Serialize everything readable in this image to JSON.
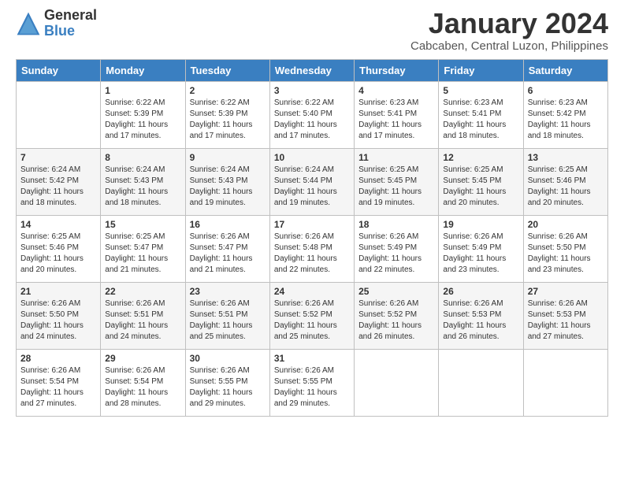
{
  "logo": {
    "general": "General",
    "blue": "Blue"
  },
  "title": "January 2024",
  "location": "Cabcaben, Central Luzon, Philippines",
  "days_of_week": [
    "Sunday",
    "Monday",
    "Tuesday",
    "Wednesday",
    "Thursday",
    "Friday",
    "Saturday"
  ],
  "weeks": [
    [
      {
        "day": "",
        "sunrise": "",
        "sunset": "",
        "daylight": ""
      },
      {
        "day": "1",
        "sunrise": "Sunrise: 6:22 AM",
        "sunset": "Sunset: 5:39 PM",
        "daylight": "Daylight: 11 hours and 17 minutes."
      },
      {
        "day": "2",
        "sunrise": "Sunrise: 6:22 AM",
        "sunset": "Sunset: 5:39 PM",
        "daylight": "Daylight: 11 hours and 17 minutes."
      },
      {
        "day": "3",
        "sunrise": "Sunrise: 6:22 AM",
        "sunset": "Sunset: 5:40 PM",
        "daylight": "Daylight: 11 hours and 17 minutes."
      },
      {
        "day": "4",
        "sunrise": "Sunrise: 6:23 AM",
        "sunset": "Sunset: 5:41 PM",
        "daylight": "Daylight: 11 hours and 17 minutes."
      },
      {
        "day": "5",
        "sunrise": "Sunrise: 6:23 AM",
        "sunset": "Sunset: 5:41 PM",
        "daylight": "Daylight: 11 hours and 18 minutes."
      },
      {
        "day": "6",
        "sunrise": "Sunrise: 6:23 AM",
        "sunset": "Sunset: 5:42 PM",
        "daylight": "Daylight: 11 hours and 18 minutes."
      }
    ],
    [
      {
        "day": "7",
        "sunrise": "Sunrise: 6:24 AM",
        "sunset": "Sunset: 5:42 PM",
        "daylight": "Daylight: 11 hours and 18 minutes."
      },
      {
        "day": "8",
        "sunrise": "Sunrise: 6:24 AM",
        "sunset": "Sunset: 5:43 PM",
        "daylight": "Daylight: 11 hours and 18 minutes."
      },
      {
        "day": "9",
        "sunrise": "Sunrise: 6:24 AM",
        "sunset": "Sunset: 5:43 PM",
        "daylight": "Daylight: 11 hours and 19 minutes."
      },
      {
        "day": "10",
        "sunrise": "Sunrise: 6:24 AM",
        "sunset": "Sunset: 5:44 PM",
        "daylight": "Daylight: 11 hours and 19 minutes."
      },
      {
        "day": "11",
        "sunrise": "Sunrise: 6:25 AM",
        "sunset": "Sunset: 5:45 PM",
        "daylight": "Daylight: 11 hours and 19 minutes."
      },
      {
        "day": "12",
        "sunrise": "Sunrise: 6:25 AM",
        "sunset": "Sunset: 5:45 PM",
        "daylight": "Daylight: 11 hours and 20 minutes."
      },
      {
        "day": "13",
        "sunrise": "Sunrise: 6:25 AM",
        "sunset": "Sunset: 5:46 PM",
        "daylight": "Daylight: 11 hours and 20 minutes."
      }
    ],
    [
      {
        "day": "14",
        "sunrise": "Sunrise: 6:25 AM",
        "sunset": "Sunset: 5:46 PM",
        "daylight": "Daylight: 11 hours and 20 minutes."
      },
      {
        "day": "15",
        "sunrise": "Sunrise: 6:25 AM",
        "sunset": "Sunset: 5:47 PM",
        "daylight": "Daylight: 11 hours and 21 minutes."
      },
      {
        "day": "16",
        "sunrise": "Sunrise: 6:26 AM",
        "sunset": "Sunset: 5:47 PM",
        "daylight": "Daylight: 11 hours and 21 minutes."
      },
      {
        "day": "17",
        "sunrise": "Sunrise: 6:26 AM",
        "sunset": "Sunset: 5:48 PM",
        "daylight": "Daylight: 11 hours and 22 minutes."
      },
      {
        "day": "18",
        "sunrise": "Sunrise: 6:26 AM",
        "sunset": "Sunset: 5:49 PM",
        "daylight": "Daylight: 11 hours and 22 minutes."
      },
      {
        "day": "19",
        "sunrise": "Sunrise: 6:26 AM",
        "sunset": "Sunset: 5:49 PM",
        "daylight": "Daylight: 11 hours and 23 minutes."
      },
      {
        "day": "20",
        "sunrise": "Sunrise: 6:26 AM",
        "sunset": "Sunset: 5:50 PM",
        "daylight": "Daylight: 11 hours and 23 minutes."
      }
    ],
    [
      {
        "day": "21",
        "sunrise": "Sunrise: 6:26 AM",
        "sunset": "Sunset: 5:50 PM",
        "daylight": "Daylight: 11 hours and 24 minutes."
      },
      {
        "day": "22",
        "sunrise": "Sunrise: 6:26 AM",
        "sunset": "Sunset: 5:51 PM",
        "daylight": "Daylight: 11 hours and 24 minutes."
      },
      {
        "day": "23",
        "sunrise": "Sunrise: 6:26 AM",
        "sunset": "Sunset: 5:51 PM",
        "daylight": "Daylight: 11 hours and 25 minutes."
      },
      {
        "day": "24",
        "sunrise": "Sunrise: 6:26 AM",
        "sunset": "Sunset: 5:52 PM",
        "daylight": "Daylight: 11 hours and 25 minutes."
      },
      {
        "day": "25",
        "sunrise": "Sunrise: 6:26 AM",
        "sunset": "Sunset: 5:52 PM",
        "daylight": "Daylight: 11 hours and 26 minutes."
      },
      {
        "day": "26",
        "sunrise": "Sunrise: 6:26 AM",
        "sunset": "Sunset: 5:53 PM",
        "daylight": "Daylight: 11 hours and 26 minutes."
      },
      {
        "day": "27",
        "sunrise": "Sunrise: 6:26 AM",
        "sunset": "Sunset: 5:53 PM",
        "daylight": "Daylight: 11 hours and 27 minutes."
      }
    ],
    [
      {
        "day": "28",
        "sunrise": "Sunrise: 6:26 AM",
        "sunset": "Sunset: 5:54 PM",
        "daylight": "Daylight: 11 hours and 27 minutes."
      },
      {
        "day": "29",
        "sunrise": "Sunrise: 6:26 AM",
        "sunset": "Sunset: 5:54 PM",
        "daylight": "Daylight: 11 hours and 28 minutes."
      },
      {
        "day": "30",
        "sunrise": "Sunrise: 6:26 AM",
        "sunset": "Sunset: 5:55 PM",
        "daylight": "Daylight: 11 hours and 29 minutes."
      },
      {
        "day": "31",
        "sunrise": "Sunrise: 6:26 AM",
        "sunset": "Sunset: 5:55 PM",
        "daylight": "Daylight: 11 hours and 29 minutes."
      },
      {
        "day": "",
        "sunrise": "",
        "sunset": "",
        "daylight": ""
      },
      {
        "day": "",
        "sunrise": "",
        "sunset": "",
        "daylight": ""
      },
      {
        "day": "",
        "sunrise": "",
        "sunset": "",
        "daylight": ""
      }
    ]
  ]
}
